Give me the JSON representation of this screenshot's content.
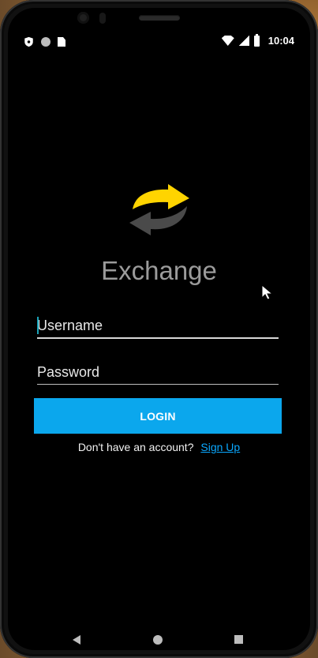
{
  "statusbar": {
    "time": "10:04",
    "left_icons": [
      "shield-icon",
      "circle-icon",
      "sd-card-icon"
    ],
    "right_icons": [
      "wifi-icon",
      "signal-icon",
      "battery-icon"
    ]
  },
  "app": {
    "title": "Exchange",
    "logo_colors": {
      "arrow_top": "#ffd400",
      "arrow_bottom": "#4a4a4a"
    }
  },
  "form": {
    "username_placeholder": "Username",
    "password_placeholder": "Password",
    "login_label": "LOGIN"
  },
  "signup": {
    "prompt": "Don't have an account?",
    "link_label": "Sign Up",
    "link_color": "#0aa8ff"
  },
  "navigation": {
    "icons": [
      "back-icon",
      "home-icon",
      "recent-apps-icon"
    ]
  }
}
